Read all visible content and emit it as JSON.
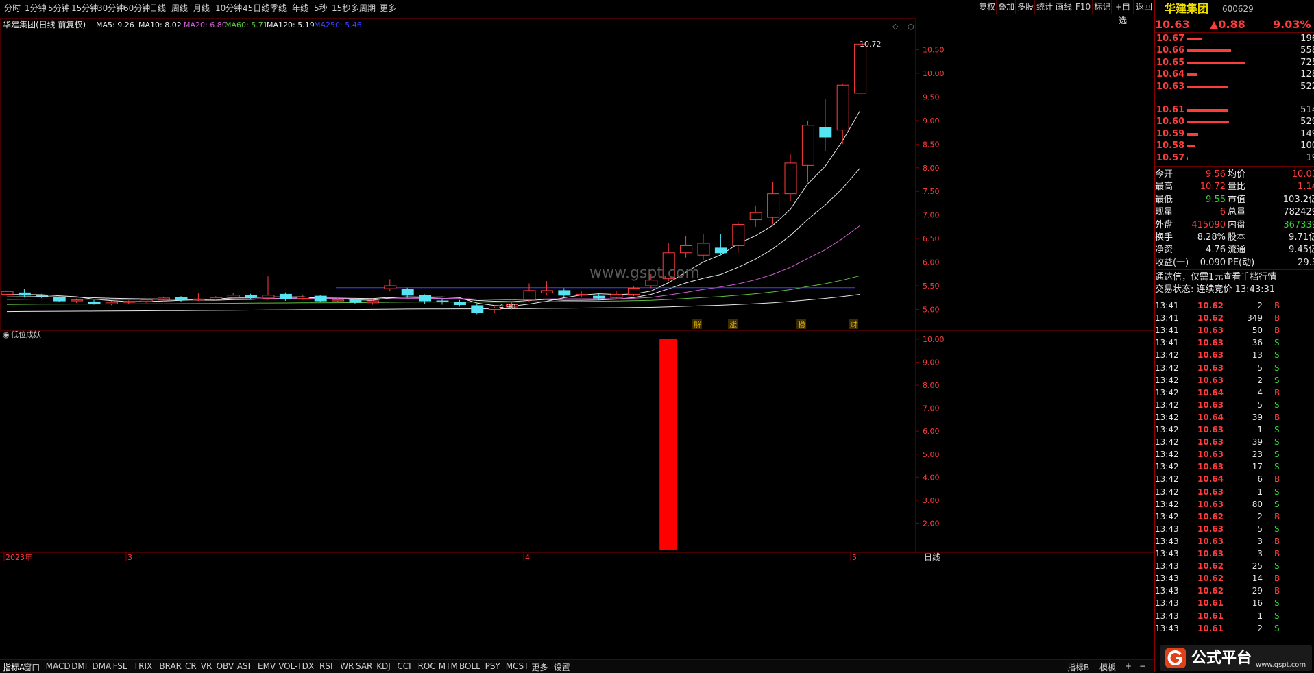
{
  "toolbar": {
    "periods": [
      "分时",
      "1分钟",
      "5分钟",
      "15分钟",
      "30分钟",
      "60分钟",
      "日线",
      "周线",
      "月线",
      "10分钟",
      "45日线",
      "季线",
      "年线",
      "5秒",
      "15秒",
      "多周期",
      "更多"
    ],
    "right_buttons": [
      "复权",
      "叠加",
      "多股",
      "统计",
      "画线",
      "F10",
      "标记",
      "+自选",
      "返回"
    ]
  },
  "legend": {
    "title": "华建集团(日线 前复权)",
    "items": [
      {
        "text": "MA5: 9.26",
        "color": "#e8e8e8"
      },
      {
        "text": "MA10: 8.02",
        "color": "#e8e8e8"
      },
      {
        "text": "MA20: 6.80",
        "color": "#d060d0"
      },
      {
        "text": "MA60: 5.71",
        "color": "#60c040"
      },
      {
        "text": "MA120: 5.19",
        "color": "#e8e8e8"
      },
      {
        "text": "MA250: 5.46",
        "color": "#4040ff"
      }
    ]
  },
  "chart_data": [
    {
      "type": "candlestick",
      "ylim": [
        4.6,
        10.9
      ],
      "y_ticks": [
        "10.50",
        "10.00",
        "9.50",
        "9.00",
        "8.50",
        "8.00",
        "7.50",
        "7.00",
        "6.50",
        "6.00",
        "5.50",
        "5.00"
      ],
      "candles": [
        [
          5.32,
          5.38,
          5.4,
          5.3
        ],
        [
          5.35,
          5.3,
          5.44,
          5.25
        ],
        [
          5.3,
          5.28,
          5.33,
          5.24
        ],
        [
          5.25,
          5.18,
          5.27,
          5.15
        ],
        [
          5.18,
          5.2,
          5.23,
          5.14
        ],
        [
          5.16,
          5.12,
          5.2,
          5.1
        ],
        [
          5.12,
          5.15,
          5.18,
          5.09
        ],
        [
          5.15,
          5.17,
          5.19,
          5.12
        ],
        [
          5.17,
          5.2,
          5.22,
          5.14
        ],
        [
          5.2,
          5.24,
          5.27,
          5.17
        ],
        [
          5.26,
          5.2,
          5.28,
          5.16
        ],
        [
          5.2,
          5.22,
          5.34,
          5.18
        ],
        [
          5.21,
          5.25,
          5.28,
          5.18
        ],
        [
          5.25,
          5.3,
          5.35,
          5.21
        ],
        [
          5.3,
          5.25,
          5.33,
          5.22
        ],
        [
          5.24,
          5.3,
          5.7,
          5.2
        ],
        [
          5.32,
          5.22,
          5.36,
          5.18
        ],
        [
          5.23,
          5.26,
          5.3,
          5.2
        ],
        [
          5.28,
          5.18,
          5.31,
          5.15
        ],
        [
          5.18,
          5.2,
          5.24,
          5.14
        ],
        [
          5.2,
          5.15,
          5.22,
          5.11
        ],
        [
          5.14,
          5.18,
          5.21,
          5.1
        ],
        [
          5.44,
          5.5,
          5.64,
          5.38
        ],
        [
          5.42,
          5.3,
          5.46,
          5.24
        ],
        [
          5.3,
          5.18,
          5.32,
          5.12
        ],
        [
          5.18,
          5.16,
          5.22,
          5.1
        ],
        [
          5.15,
          5.1,
          5.2,
          5.06
        ],
        [
          5.08,
          4.94,
          5.12,
          4.9
        ],
        [
          5.0,
          5.03,
          5.06,
          4.92
        ],
        [
          5.05,
          5.1,
          5.15,
          5.0
        ],
        [
          5.2,
          5.4,
          5.55,
          5.15
        ],
        [
          5.35,
          5.4,
          5.6,
          5.3
        ],
        [
          5.4,
          5.3,
          5.45,
          5.25
        ],
        [
          5.3,
          5.32,
          5.38,
          5.26
        ],
        [
          5.28,
          5.24,
          5.33,
          5.2
        ],
        [
          5.25,
          5.32,
          5.4,
          5.22
        ],
        [
          5.32,
          5.45,
          5.5,
          5.28
        ],
        [
          5.5,
          5.62,
          5.75,
          5.45
        ],
        [
          5.65,
          6.2,
          6.4,
          5.6
        ],
        [
          6.2,
          6.35,
          6.55,
          6.1
        ],
        [
          6.15,
          6.4,
          6.6,
          6.05
        ],
        [
          6.3,
          6.2,
          6.6,
          6.15
        ],
        [
          6.35,
          6.8,
          6.85,
          6.2
        ],
        [
          6.9,
          7.05,
          7.2,
          6.75
        ],
        [
          6.95,
          7.45,
          7.7,
          6.8
        ],
        [
          7.45,
          8.1,
          8.3,
          7.3
        ],
        [
          8.05,
          8.9,
          9.0,
          7.7
        ],
        [
          8.85,
          8.65,
          9.45,
          8.35
        ],
        [
          8.8,
          9.75,
          9.78,
          8.5
        ],
        [
          9.58,
          10.62,
          10.72,
          9.55
        ]
      ],
      "annotations": {
        "high": "10.72",
        "low": "4.90",
        "watermark": "www.gspt.com",
        "event_labels": [
          "解",
          "涨",
          "稳",
          "财"
        ]
      }
    },
    {
      "type": "bar",
      "title": "低位成妖",
      "ylim": [
        1.0,
        10.0
      ],
      "y_ticks": [
        "10.00",
        "9.00",
        "8.00",
        "7.00",
        "6.00",
        "5.00",
        "4.00",
        "3.00",
        "2.00"
      ],
      "values": [
        {
          "index": 38,
          "value": 10
        }
      ]
    }
  ],
  "date_labels": [
    "2023年",
    "3",
    "4",
    "5"
  ],
  "timeframe_label": "日线",
  "tabs": [
    "指标A",
    "窗口",
    "MACD",
    "DMI",
    "DMA",
    "FSL",
    "TRIX",
    "BRAR",
    "CR",
    "VR",
    "OBV",
    "ASI",
    "EMV",
    "VOL-TDX",
    "RSI",
    "WR",
    "SAR",
    "KDJ",
    "CCI",
    "ROC",
    "MTM",
    "BOLL",
    "PSY",
    "MCST",
    "更多",
    "设置"
  ],
  "tabs_right": [
    "指标B",
    "模板",
    "+",
    "−"
  ],
  "stock": {
    "name": "华建集团",
    "code": "600629",
    "price": "10.63",
    "change": "▲0.88",
    "pct": "9.03%"
  },
  "asks": [
    {
      "price": "10.67",
      "vol": "196"
    },
    {
      "price": "10.66",
      "vol": "558"
    },
    {
      "price": "10.65",
      "vol": "725"
    },
    {
      "price": "10.64",
      "vol": "128"
    },
    {
      "price": "10.63",
      "vol": "522"
    }
  ],
  "bids": [
    {
      "price": "10.61",
      "vol": "514"
    },
    {
      "price": "10.60",
      "vol": "529"
    },
    {
      "price": "10.59",
      "vol": "149"
    },
    {
      "price": "10.58",
      "vol": "100"
    },
    {
      "price": "10.57",
      "vol": "19"
    }
  ],
  "stats": [
    {
      "l1": "今开",
      "v1": "9.56",
      "c1": "red",
      "l2": "均价",
      "v2": "10.03",
      "c2": "red"
    },
    {
      "l1": "最高",
      "v1": "10.72",
      "c1": "red",
      "l2": "量比",
      "v2": "1.14",
      "c2": "red"
    },
    {
      "l1": "最低",
      "v1": "9.55",
      "c1": "green",
      "l2": "市值",
      "v2": "103.2亿",
      "c2": "white"
    },
    {
      "l1": "现量",
      "v1": "6",
      "c1": "red",
      "l2": "总量",
      "v2": "782429",
      "c2": "white"
    },
    {
      "l1": "外盘",
      "v1": "415090",
      "c1": "red",
      "l2": "内盘",
      "v2": "367339",
      "c2": "green"
    },
    {
      "l1": "换手",
      "v1": "8.28%",
      "c1": "white",
      "l2": "股本",
      "v2": "9.71亿",
      "c2": "white"
    },
    {
      "l1": "净资",
      "v1": "4.76",
      "c1": "white",
      "l2": "流通",
      "v2": "9.45亿",
      "c2": "white"
    },
    {
      "l1": "收益(一)",
      "v1": "0.090",
      "c1": "white",
      "l2": "PE(动)",
      "v2": "29.3",
      "c2": "white"
    }
  ],
  "notice": "通达信，仅需1元查看千档行情",
  "trade_status": "交易状态: 连续竞价 13:43:31",
  "ticks": [
    [
      "13:41",
      "10.62",
      "2",
      "B"
    ],
    [
      "13:41",
      "10.62",
      "349",
      "B"
    ],
    [
      "13:41",
      "10.63",
      "50",
      "B"
    ],
    [
      "13:41",
      "10.63",
      "36",
      "S"
    ],
    [
      "13:42",
      "10.63",
      "13",
      "S"
    ],
    [
      "13:42",
      "10.63",
      "5",
      "S"
    ],
    [
      "13:42",
      "10.63",
      "2",
      "S"
    ],
    [
      "13:42",
      "10.64",
      "4",
      "B"
    ],
    [
      "13:42",
      "10.63",
      "5",
      "S"
    ],
    [
      "13:42",
      "10.64",
      "39",
      "B"
    ],
    [
      "13:42",
      "10.63",
      "1",
      "S"
    ],
    [
      "13:42",
      "10.63",
      "39",
      "S"
    ],
    [
      "13:42",
      "10.63",
      "23",
      "S"
    ],
    [
      "13:42",
      "10.63",
      "17",
      "S"
    ],
    [
      "13:42",
      "10.64",
      "6",
      "B"
    ],
    [
      "13:42",
      "10.63",
      "1",
      "S"
    ],
    [
      "13:42",
      "10.63",
      "80",
      "S"
    ],
    [
      "13:42",
      "10.62",
      "2",
      "B"
    ],
    [
      "13:43",
      "10.63",
      "5",
      "S"
    ],
    [
      "13:43",
      "10.63",
      "3",
      "B"
    ],
    [
      "13:43",
      "10.63",
      "3",
      "B"
    ],
    [
      "13:43",
      "10.62",
      "25",
      "S"
    ],
    [
      "13:43",
      "10.62",
      "14",
      "B"
    ],
    [
      "13:43",
      "10.62",
      "29",
      "B"
    ],
    [
      "13:43",
      "10.61",
      "16",
      "S"
    ],
    [
      "13:43",
      "10.61",
      "1",
      "S"
    ],
    [
      "13:43",
      "10.61",
      "2",
      "S"
    ]
  ],
  "brand": {
    "text": "公式平台",
    "url": "www.gspt.com"
  }
}
